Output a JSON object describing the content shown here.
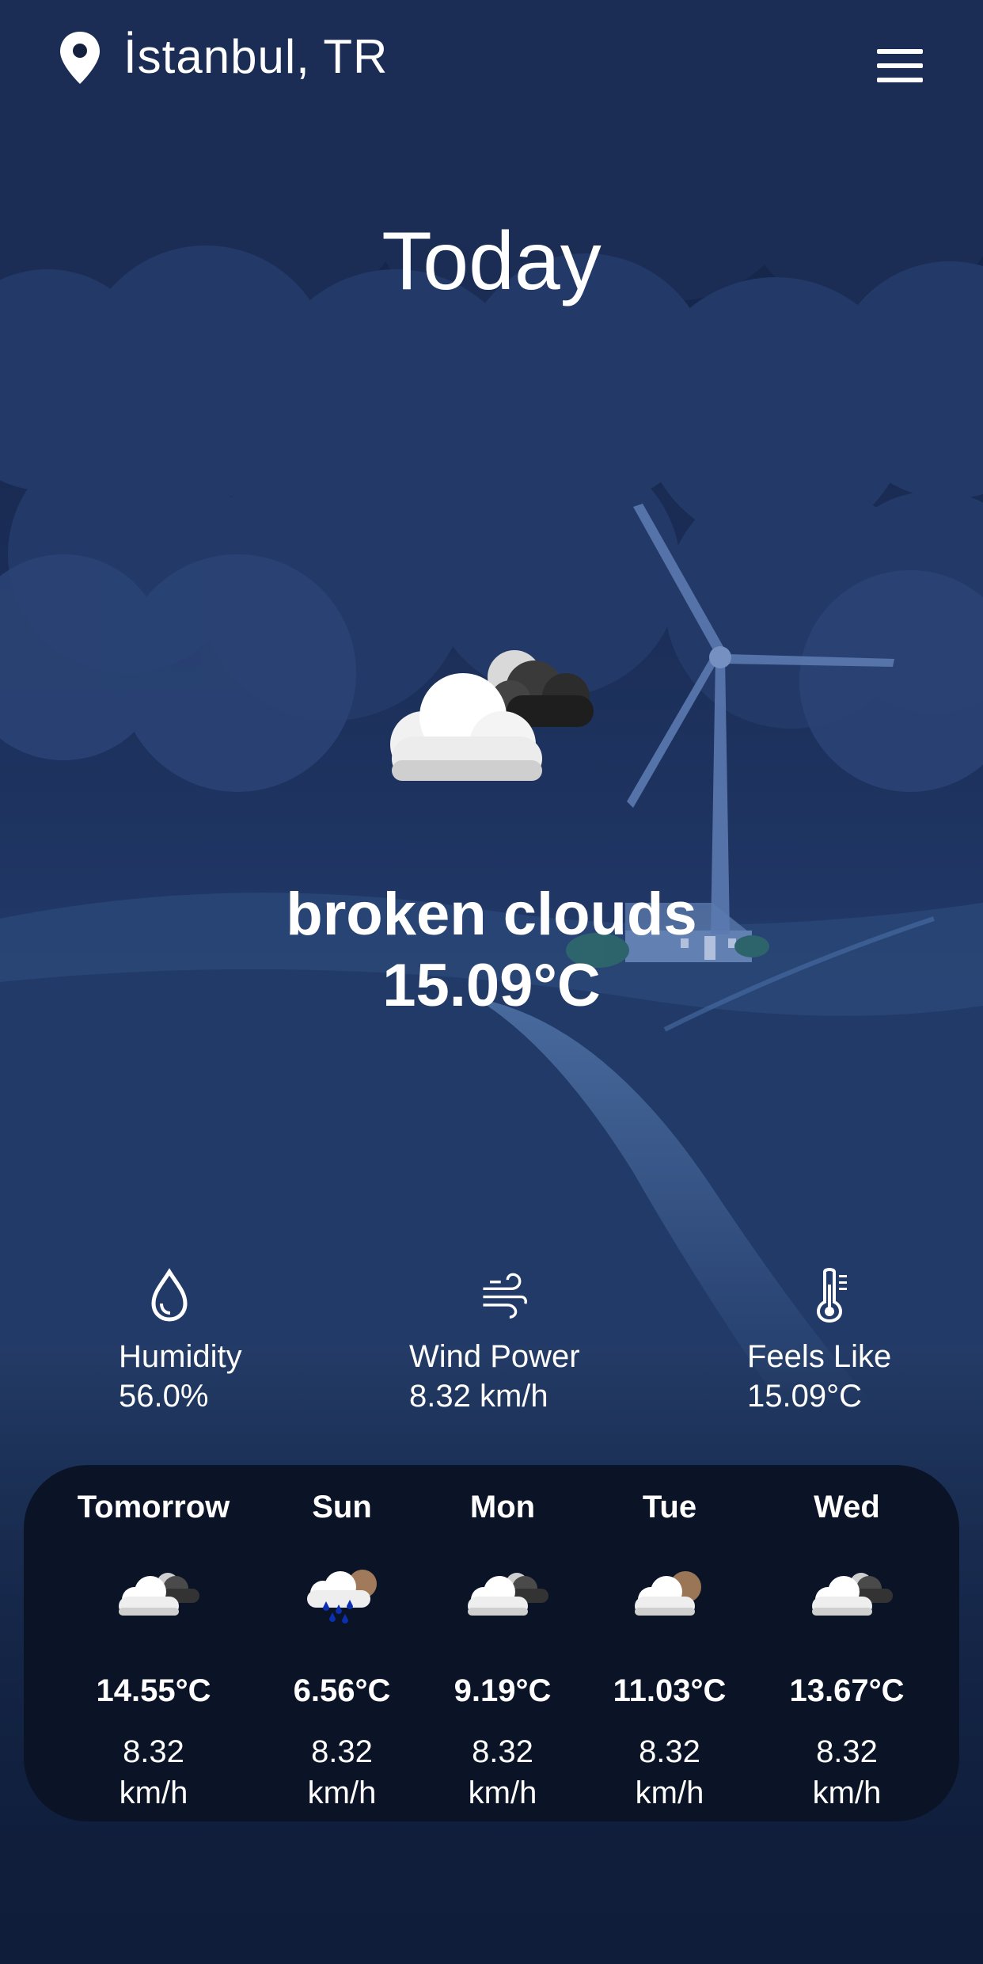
{
  "header": {
    "location": "İstanbul, TR",
    "location_icon": "map-pin-icon",
    "menu_icon": "hamburger-menu-icon"
  },
  "hero": {
    "title": "Today",
    "condition": "broken clouds",
    "temperature": "15.09°C",
    "condition_icon": "broken-clouds-icon"
  },
  "stats": [
    {
      "label": "Humidity",
      "value": "56.0%",
      "icon": "droplet-icon"
    },
    {
      "label": "Wind Power",
      "value": "8.32 km/h",
      "icon": "wind-icon"
    },
    {
      "label": "Feels Like",
      "value": "15.09°C",
      "icon": "thermometer-icon"
    }
  ],
  "forecast": [
    {
      "day": "Tomorrow",
      "temp": "14.55°C",
      "wind_value": "8.32",
      "wind_unit": "km/h",
      "icon": "broken-clouds-icon"
    },
    {
      "day": "Sun",
      "temp": "6.56°C",
      "wind_value": "8.32",
      "wind_unit": "km/h",
      "icon": "rain-cloud-icon"
    },
    {
      "day": "Mon",
      "temp": "9.19°C",
      "wind_value": "8.32",
      "wind_unit": "km/h",
      "icon": "broken-clouds-icon"
    },
    {
      "day": "Tue",
      "temp": "11.03°C",
      "wind_value": "8.32",
      "wind_unit": "km/h",
      "icon": "cloudy-brown-icon"
    },
    {
      "day": "Wed",
      "temp": "13.67°C",
      "wind_value": "8.32",
      "wind_unit": "km/h",
      "icon": "broken-clouds-icon"
    }
  ],
  "colors": {
    "background": "#0f1d3a",
    "card": "#0b1427",
    "text": "#ffffff"
  }
}
